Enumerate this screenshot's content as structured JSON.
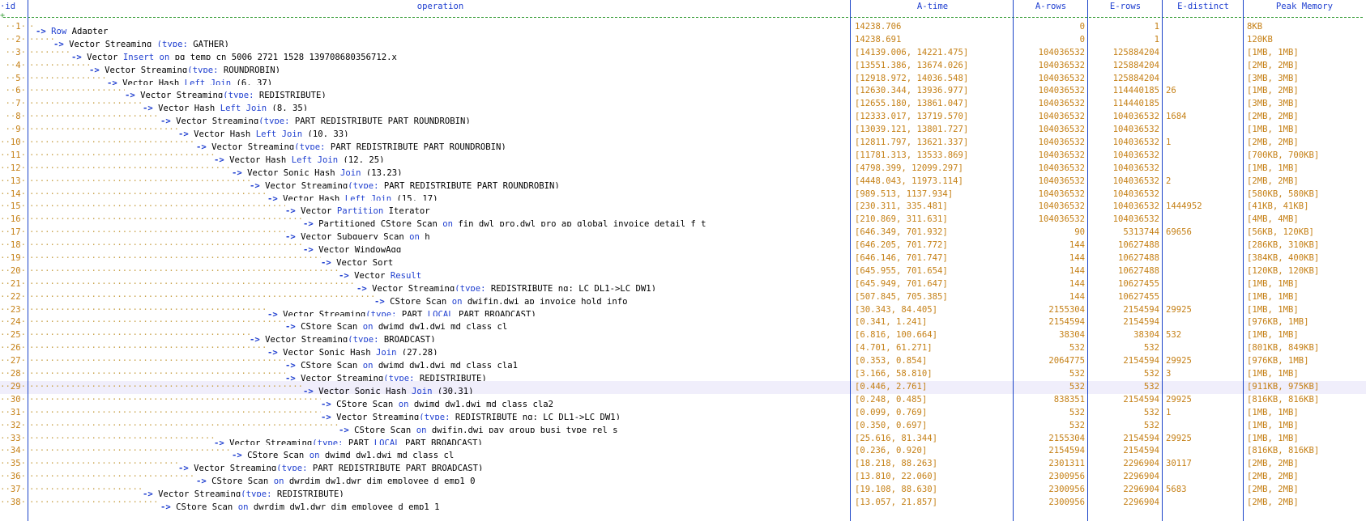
{
  "columns": {
    "id": "id",
    "operation": "operation",
    "a_time": "A-time",
    "a_rows": "A-rows",
    "e_rows": "E-rows",
    "e_distinct": "E-distinct",
    "peak_memory": "Peak Memory"
  },
  "colors": {
    "keyword": "#1f3fd0",
    "number": "#c58016",
    "dots": "#c8a24a",
    "highlight_row": "#f0eefb",
    "separator": "#3a9e3a"
  },
  "selected_row_id": "29",
  "rows": [
    {
      "id": "1",
      "depth": 0,
      "op": [
        [
          "kw",
          "Row"
        ],
        [
          "t",
          " Adapter"
        ]
      ],
      "a_time": "14238.706",
      "a_rows": "0",
      "e_rows": "1",
      "e_distinct": "",
      "peak_memory": "8KB"
    },
    {
      "id": "2",
      "depth": 1,
      "op": [
        [
          "t",
          "Vector Streaming "
        ],
        [
          "kw",
          "(type:"
        ],
        [
          "t",
          " GATHER)"
        ]
      ],
      "a_time": "14238.691",
      "a_rows": "0",
      "e_rows": "1",
      "e_distinct": "",
      "peak_memory": "120KB"
    },
    {
      "id": "3",
      "depth": 2,
      "op": [
        [
          "t",
          "Vector "
        ],
        [
          "kw",
          "Insert"
        ],
        [
          "t",
          " "
        ],
        [
          "kw",
          "on"
        ],
        [
          "t",
          " pg_temp_cn_5006_2721_1528_139708680356712.x"
        ]
      ],
      "a_time": "[14139.006, 14221.475]",
      "a_rows": "104036532",
      "e_rows": "125884204",
      "e_distinct": "",
      "peak_memory": "[1MB, 1MB]"
    },
    {
      "id": "4",
      "depth": 3,
      "op": [
        [
          "t",
          "Vector Streaming"
        ],
        [
          "kw",
          "(type:"
        ],
        [
          "t",
          " ROUNDROBIN)"
        ]
      ],
      "a_time": "[13551.386, 13674.026]",
      "a_rows": "104036532",
      "e_rows": "125884204",
      "e_distinct": "",
      "peak_memory": "[2MB, 2MB]"
    },
    {
      "id": "5",
      "depth": 4,
      "op": [
        [
          "t",
          "Vector Hash "
        ],
        [
          "kw",
          "Left Join"
        ],
        [
          "t",
          " (6, 37)"
        ]
      ],
      "a_time": "[12918.972, 14036.548]",
      "a_rows": "104036532",
      "e_rows": "125884204",
      "e_distinct": "",
      "peak_memory": "[3MB, 3MB]"
    },
    {
      "id": "6",
      "depth": 5,
      "op": [
        [
          "t",
          "Vector Streaming"
        ],
        [
          "kw",
          "(type:"
        ],
        [
          "t",
          " REDISTRIBUTE)"
        ]
      ],
      "a_time": "[12630.344, 13936.977]",
      "a_rows": "104036532",
      "e_rows": "114440185",
      "e_distinct": "26",
      "peak_memory": "[1MB, 2MB]"
    },
    {
      "id": "7",
      "depth": 6,
      "op": [
        [
          "t",
          "Vector Hash "
        ],
        [
          "kw",
          "Left Join"
        ],
        [
          "t",
          " (8, 35)"
        ]
      ],
      "a_time": "[12655.180, 13861.047]",
      "a_rows": "104036532",
      "e_rows": "114440185",
      "e_distinct": "",
      "peak_memory": "[3MB, 3MB]"
    },
    {
      "id": "8",
      "depth": 7,
      "op": [
        [
          "t",
          "Vector Streaming"
        ],
        [
          "kw",
          "(type:"
        ],
        [
          "t",
          " PART REDISTRIBUTE PART ROUNDROBIN)"
        ]
      ],
      "a_time": "[12333.017, 13719.570]",
      "a_rows": "104036532",
      "e_rows": "104036532",
      "e_distinct": "1684",
      "peak_memory": "[2MB, 2MB]"
    },
    {
      "id": "9",
      "depth": 8,
      "op": [
        [
          "t",
          "Vector Hash "
        ],
        [
          "kw",
          "Left Join"
        ],
        [
          "t",
          " (10, 33)"
        ]
      ],
      "a_time": "[13039.121, 13801.727]",
      "a_rows": "104036532",
      "e_rows": "104036532",
      "e_distinct": "",
      "peak_memory": "[1MB, 1MB]"
    },
    {
      "id": "10",
      "depth": 9,
      "op": [
        [
          "t",
          "Vector Streaming"
        ],
        [
          "kw",
          "(type:"
        ],
        [
          "t",
          " PART REDISTRIBUTE PART ROUNDROBIN)"
        ]
      ],
      "a_time": "[12811.797, 13621.337]",
      "a_rows": "104036532",
      "e_rows": "104036532",
      "e_distinct": "1",
      "peak_memory": "[2MB, 2MB]"
    },
    {
      "id": "11",
      "depth": 10,
      "op": [
        [
          "t",
          "Vector Hash "
        ],
        [
          "kw",
          "Left Join"
        ],
        [
          "t",
          " (12, 25)"
        ]
      ],
      "a_time": "[11781.313, 13533.869]",
      "a_rows": "104036532",
      "e_rows": "104036532",
      "e_distinct": "",
      "peak_memory": "[700KB, 700KB]"
    },
    {
      "id": "12",
      "depth": 11,
      "op": [
        [
          "t",
          "Vector Sonic Hash "
        ],
        [
          "kw",
          "Join"
        ],
        [
          "t",
          " (13,23)"
        ]
      ],
      "a_time": "[4798.399, 12099.297]",
      "a_rows": "104036532",
      "e_rows": "104036532",
      "e_distinct": "",
      "peak_memory": "[1MB, 1MB]"
    },
    {
      "id": "13",
      "depth": 12,
      "op": [
        [
          "t",
          "Vector Streaming"
        ],
        [
          "kw",
          "(type:"
        ],
        [
          "t",
          " PART REDISTRIBUTE PART ROUNDROBIN)"
        ]
      ],
      "a_time": "[4448.043, 11973.114]",
      "a_rows": "104036532",
      "e_rows": "104036532",
      "e_distinct": "2",
      "peak_memory": "[2MB, 2MB]"
    },
    {
      "id": "14",
      "depth": 13,
      "op": [
        [
          "t",
          "Vector Hash "
        ],
        [
          "kw",
          "Left Join"
        ],
        [
          "t",
          " (15, 17)"
        ]
      ],
      "a_time": "[989.513, 1137.934]",
      "a_rows": "104036532",
      "e_rows": "104036532",
      "e_distinct": "",
      "peak_memory": "[580KB, 580KB]"
    },
    {
      "id": "15",
      "depth": 14,
      "op": [
        [
          "t",
          "Vector "
        ],
        [
          "kw",
          "Partition"
        ],
        [
          "t",
          " Iterator"
        ]
      ],
      "a_time": "[230.311, 335.481]",
      "a_rows": "104036532",
      "e_rows": "104036532",
      "e_distinct": "1444952",
      "peak_memory": "[41KB, 41KB]"
    },
    {
      "id": "16",
      "depth": 15,
      "op": [
        [
          "t",
          "Partitioned CStore Scan "
        ],
        [
          "kw",
          "on"
        ],
        [
          "t",
          " fin_dwl_pro.dwl_pro_ap_global_invoice_detail_f t"
        ]
      ],
      "a_time": "[210.869, 311.631]",
      "a_rows": "104036532",
      "e_rows": "104036532",
      "e_distinct": "",
      "peak_memory": "[4MB, 4MB]"
    },
    {
      "id": "17",
      "depth": 14,
      "op": [
        [
          "t",
          "Vector Subquery Scan "
        ],
        [
          "kw",
          "on"
        ],
        [
          "t",
          " h"
        ]
      ],
      "a_time": "[646.349, 701.932]",
      "a_rows": "90",
      "e_rows": "5313744",
      "e_distinct": "69656",
      "peak_memory": "[56KB, 120KB]"
    },
    {
      "id": "18",
      "depth": 15,
      "op": [
        [
          "t",
          "Vector WindowAgg"
        ]
      ],
      "a_time": "[646.205, 701.772]",
      "a_rows": "144",
      "e_rows": "10627488",
      "e_distinct": "",
      "peak_memory": "[286KB, 310KB]"
    },
    {
      "id": "19",
      "depth": 16,
      "op": [
        [
          "t",
          "Vector Sort"
        ]
      ],
      "a_time": "[646.146, 701.747]",
      "a_rows": "144",
      "e_rows": "10627488",
      "e_distinct": "",
      "peak_memory": "[384KB, 400KB]"
    },
    {
      "id": "20",
      "depth": 17,
      "op": [
        [
          "t",
          "Vector "
        ],
        [
          "kw",
          "Result"
        ]
      ],
      "a_time": "[645.955, 701.654]",
      "a_rows": "144",
      "e_rows": "10627488",
      "e_distinct": "",
      "peak_memory": "[120KB, 120KB]"
    },
    {
      "id": "21",
      "depth": 18,
      "op": [
        [
          "t",
          "Vector Streaming"
        ],
        [
          "kw",
          "(type:"
        ],
        [
          "t",
          " REDISTRIBUTE ng: LC_DL1->LC_DW1)"
        ]
      ],
      "a_time": "[645.949, 701.647]",
      "a_rows": "144",
      "e_rows": "10627455",
      "e_distinct": "",
      "peak_memory": "[1MB, 1MB]"
    },
    {
      "id": "22",
      "depth": 19,
      "op": [
        [
          "t",
          "CStore Scan "
        ],
        [
          "kw",
          "on"
        ],
        [
          "t",
          " dwifin.dwi_ap_invoice_hold_info"
        ]
      ],
      "a_time": "[507.845, 705.385]",
      "a_rows": "144",
      "e_rows": "10627455",
      "e_distinct": "",
      "peak_memory": "[1MB, 1MB]"
    },
    {
      "id": "23",
      "depth": 13,
      "op": [
        [
          "t",
          "Vector Streaming"
        ],
        [
          "kw",
          "(type:"
        ],
        [
          "t",
          " PART "
        ],
        [
          "kw",
          "LOCAL"
        ],
        [
          "t",
          " PART BROADCAST)"
        ]
      ],
      "a_time": "[30.343, 84.405]",
      "a_rows": "2155304",
      "e_rows": "2154594",
      "e_distinct": "29925",
      "peak_memory": "[1MB, 1MB]"
    },
    {
      "id": "24",
      "depth": 14,
      "op": [
        [
          "t",
          "CStore Scan "
        ],
        [
          "kw",
          "on"
        ],
        [
          "t",
          " dwimd_dw1.dwi_md_class cl"
        ]
      ],
      "a_time": "[0.341, 1.241]",
      "a_rows": "2154594",
      "e_rows": "2154594",
      "e_distinct": "",
      "peak_memory": "[976KB, 1MB]"
    },
    {
      "id": "25",
      "depth": 12,
      "op": [
        [
          "t",
          "Vector Streaming"
        ],
        [
          "kw",
          "(type:"
        ],
        [
          "t",
          " BROADCAST)"
        ]
      ],
      "a_time": "[6.816, 100.664]",
      "a_rows": "38304",
      "e_rows": "38304",
      "e_distinct": "532",
      "peak_memory": "[1MB, 1MB]"
    },
    {
      "id": "26",
      "depth": 13,
      "op": [
        [
          "t",
          "Vector Sonic Hash "
        ],
        [
          "kw",
          "Join"
        ],
        [
          "t",
          " (27,28)"
        ]
      ],
      "a_time": "[4.701, 61.271]",
      "a_rows": "532",
      "e_rows": "532",
      "e_distinct": "",
      "peak_memory": "[801KB, 849KB]"
    },
    {
      "id": "27",
      "depth": 14,
      "op": [
        [
          "t",
          "CStore Scan "
        ],
        [
          "kw",
          "on"
        ],
        [
          "t",
          " dwimd_dw1.dwi_md_class cla1"
        ]
      ],
      "a_time": "[0.353, 0.854]",
      "a_rows": "2064775",
      "e_rows": "2154594",
      "e_distinct": "29925",
      "peak_memory": "[976KB, 1MB]"
    },
    {
      "id": "28",
      "depth": 14,
      "op": [
        [
          "t",
          "Vector Streaming"
        ],
        [
          "kw",
          "(type:"
        ],
        [
          "t",
          " REDISTRIBUTE)"
        ]
      ],
      "a_time": "[3.166, 58.810]",
      "a_rows": "532",
      "e_rows": "532",
      "e_distinct": "3",
      "peak_memory": "[1MB, 1MB]"
    },
    {
      "id": "29",
      "depth": 15,
      "op": [
        [
          "t",
          "Vector Sonic Hash "
        ],
        [
          "kw",
          "Join"
        ],
        [
          "t",
          " (30,31)"
        ]
      ],
      "a_time": "[0.446, 2.761]",
      "a_rows": "532",
      "e_rows": "532",
      "e_distinct": "",
      "peak_memory": "[911KB, 975KB]"
    },
    {
      "id": "30",
      "depth": 16,
      "op": [
        [
          "t",
          "CStore Scan "
        ],
        [
          "kw",
          "on"
        ],
        [
          "t",
          " dwimd_dw1.dwi_md_class cla2"
        ]
      ],
      "a_time": "[0.248, 0.485]",
      "a_rows": "838351",
      "e_rows": "2154594",
      "e_distinct": "29925",
      "peak_memory": "[816KB, 816KB]"
    },
    {
      "id": "31",
      "depth": 16,
      "op": [
        [
          "t",
          "Vector Streaming"
        ],
        [
          "kw",
          "(type:"
        ],
        [
          "t",
          " REDISTRIBUTE ng: LC_DL1->LC_DW1)"
        ]
      ],
      "a_time": "[0.099, 0.769]",
      "a_rows": "532",
      "e_rows": "532",
      "e_distinct": "1",
      "peak_memory": "[1MB, 1MB]"
    },
    {
      "id": "32",
      "depth": 17,
      "op": [
        [
          "t",
          "CStore Scan "
        ],
        [
          "kw",
          "on"
        ],
        [
          "t",
          " dwifin.dwi_pay_group_busi_type_rel s"
        ]
      ],
      "a_time": "[0.350, 0.697]",
      "a_rows": "532",
      "e_rows": "532",
      "e_distinct": "",
      "peak_memory": "[1MB, 1MB]"
    },
    {
      "id": "33",
      "depth": 10,
      "op": [
        [
          "t",
          "Vector Streaming"
        ],
        [
          "kw",
          "(type:"
        ],
        [
          "t",
          " PART "
        ],
        [
          "kw",
          "LOCAL"
        ],
        [
          "t",
          " PART BROADCAST)"
        ]
      ],
      "a_time": "[25.616, 81.344]",
      "a_rows": "2155304",
      "e_rows": "2154594",
      "e_distinct": "29925",
      "peak_memory": "[1MB, 1MB]"
    },
    {
      "id": "34",
      "depth": 11,
      "op": [
        [
          "t",
          "CStore Scan "
        ],
        [
          "kw",
          "on"
        ],
        [
          "t",
          " dwimd_dw1.dwi_md_class cl"
        ]
      ],
      "a_time": "[0.236, 0.920]",
      "a_rows": "2154594",
      "e_rows": "2154594",
      "e_distinct": "",
      "peak_memory": "[816KB, 816KB]"
    },
    {
      "id": "35",
      "depth": 8,
      "op": [
        [
          "t",
          "Vector Streaming"
        ],
        [
          "kw",
          "(type:"
        ],
        [
          "t",
          " PART REDISTRIBUTE PART BROADCAST)"
        ]
      ],
      "a_time": "[18.218, 88.263]",
      "a_rows": "2301311",
      "e_rows": "2296904",
      "e_distinct": "30117",
      "peak_memory": "[2MB, 2MB]"
    },
    {
      "id": "36",
      "depth": 9,
      "op": [
        [
          "t",
          "CStore Scan "
        ],
        [
          "kw",
          "on"
        ],
        [
          "t",
          " dwrdim_dw1.dwr_dim_employee_d emp1_0"
        ]
      ],
      "a_time": "[13.810, 22.060]",
      "a_rows": "2300956",
      "e_rows": "2296904",
      "e_distinct": "",
      "peak_memory": "[2MB, 2MB]"
    },
    {
      "id": "37",
      "depth": 6,
      "op": [
        [
          "t",
          "Vector Streaming"
        ],
        [
          "kw",
          "(type:"
        ],
        [
          "t",
          " REDISTRIBUTE)"
        ]
      ],
      "a_time": "[19.108, 88.630]",
      "a_rows": "2300956",
      "e_rows": "2296904",
      "e_distinct": "5683",
      "peak_memory": "[2MB, 2MB]"
    },
    {
      "id": "38",
      "depth": 7,
      "op": [
        [
          "t",
          "CStore Scan "
        ],
        [
          "kw",
          "on"
        ],
        [
          "t",
          " dwrdim_dw1.dwr_dim_employee_d emp1_1"
        ]
      ],
      "a_time": "[13.057, 21.857]",
      "a_rows": "2300956",
      "e_rows": "2296904",
      "e_distinct": "",
      "peak_memory": "[2MB, 2MB]"
    }
  ]
}
